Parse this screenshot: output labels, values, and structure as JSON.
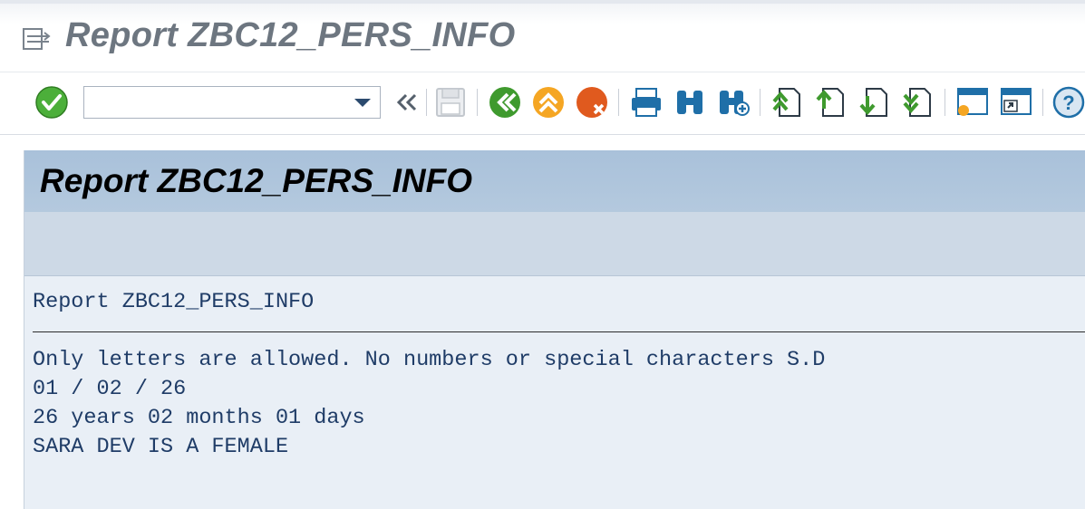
{
  "window": {
    "title": "Report ZBC12_PERS_INFO"
  },
  "toolbar": {
    "command_field_value": "",
    "buttons": [
      {
        "name": "enter-icon",
        "color": "#4caf3a"
      },
      {
        "name": "back-history-icon"
      },
      {
        "name": "save-icon"
      },
      {
        "name": "back-icon",
        "color": "#3f9a2e"
      },
      {
        "name": "exit-icon",
        "color": "#f5a623"
      },
      {
        "name": "cancel-icon",
        "color": "#e05a1e"
      },
      {
        "name": "print-icon"
      },
      {
        "name": "find-icon"
      },
      {
        "name": "find-next-icon"
      },
      {
        "name": "first-page-icon"
      },
      {
        "name": "previous-page-icon"
      },
      {
        "name": "next-page-icon"
      },
      {
        "name": "last-page-icon"
      },
      {
        "name": "create-session-icon"
      },
      {
        "name": "shortcut-icon"
      },
      {
        "name": "help-icon"
      }
    ]
  },
  "report": {
    "header_title": "Report ZBC12_PERS_INFO",
    "list_title": "Report ZBC12_PERS_INFO",
    "lines": [
      "Only letters are allowed. No numbers or special characters S.D",
      "01 / 02 / 26",
      "26 years 02 months 01 days",
      "SARA DEV IS A FEMALE"
    ]
  },
  "colors": {
    "header_bar": "#afc5dc",
    "content_bg": "#e9eff6",
    "list_text": "#1f3c67"
  }
}
